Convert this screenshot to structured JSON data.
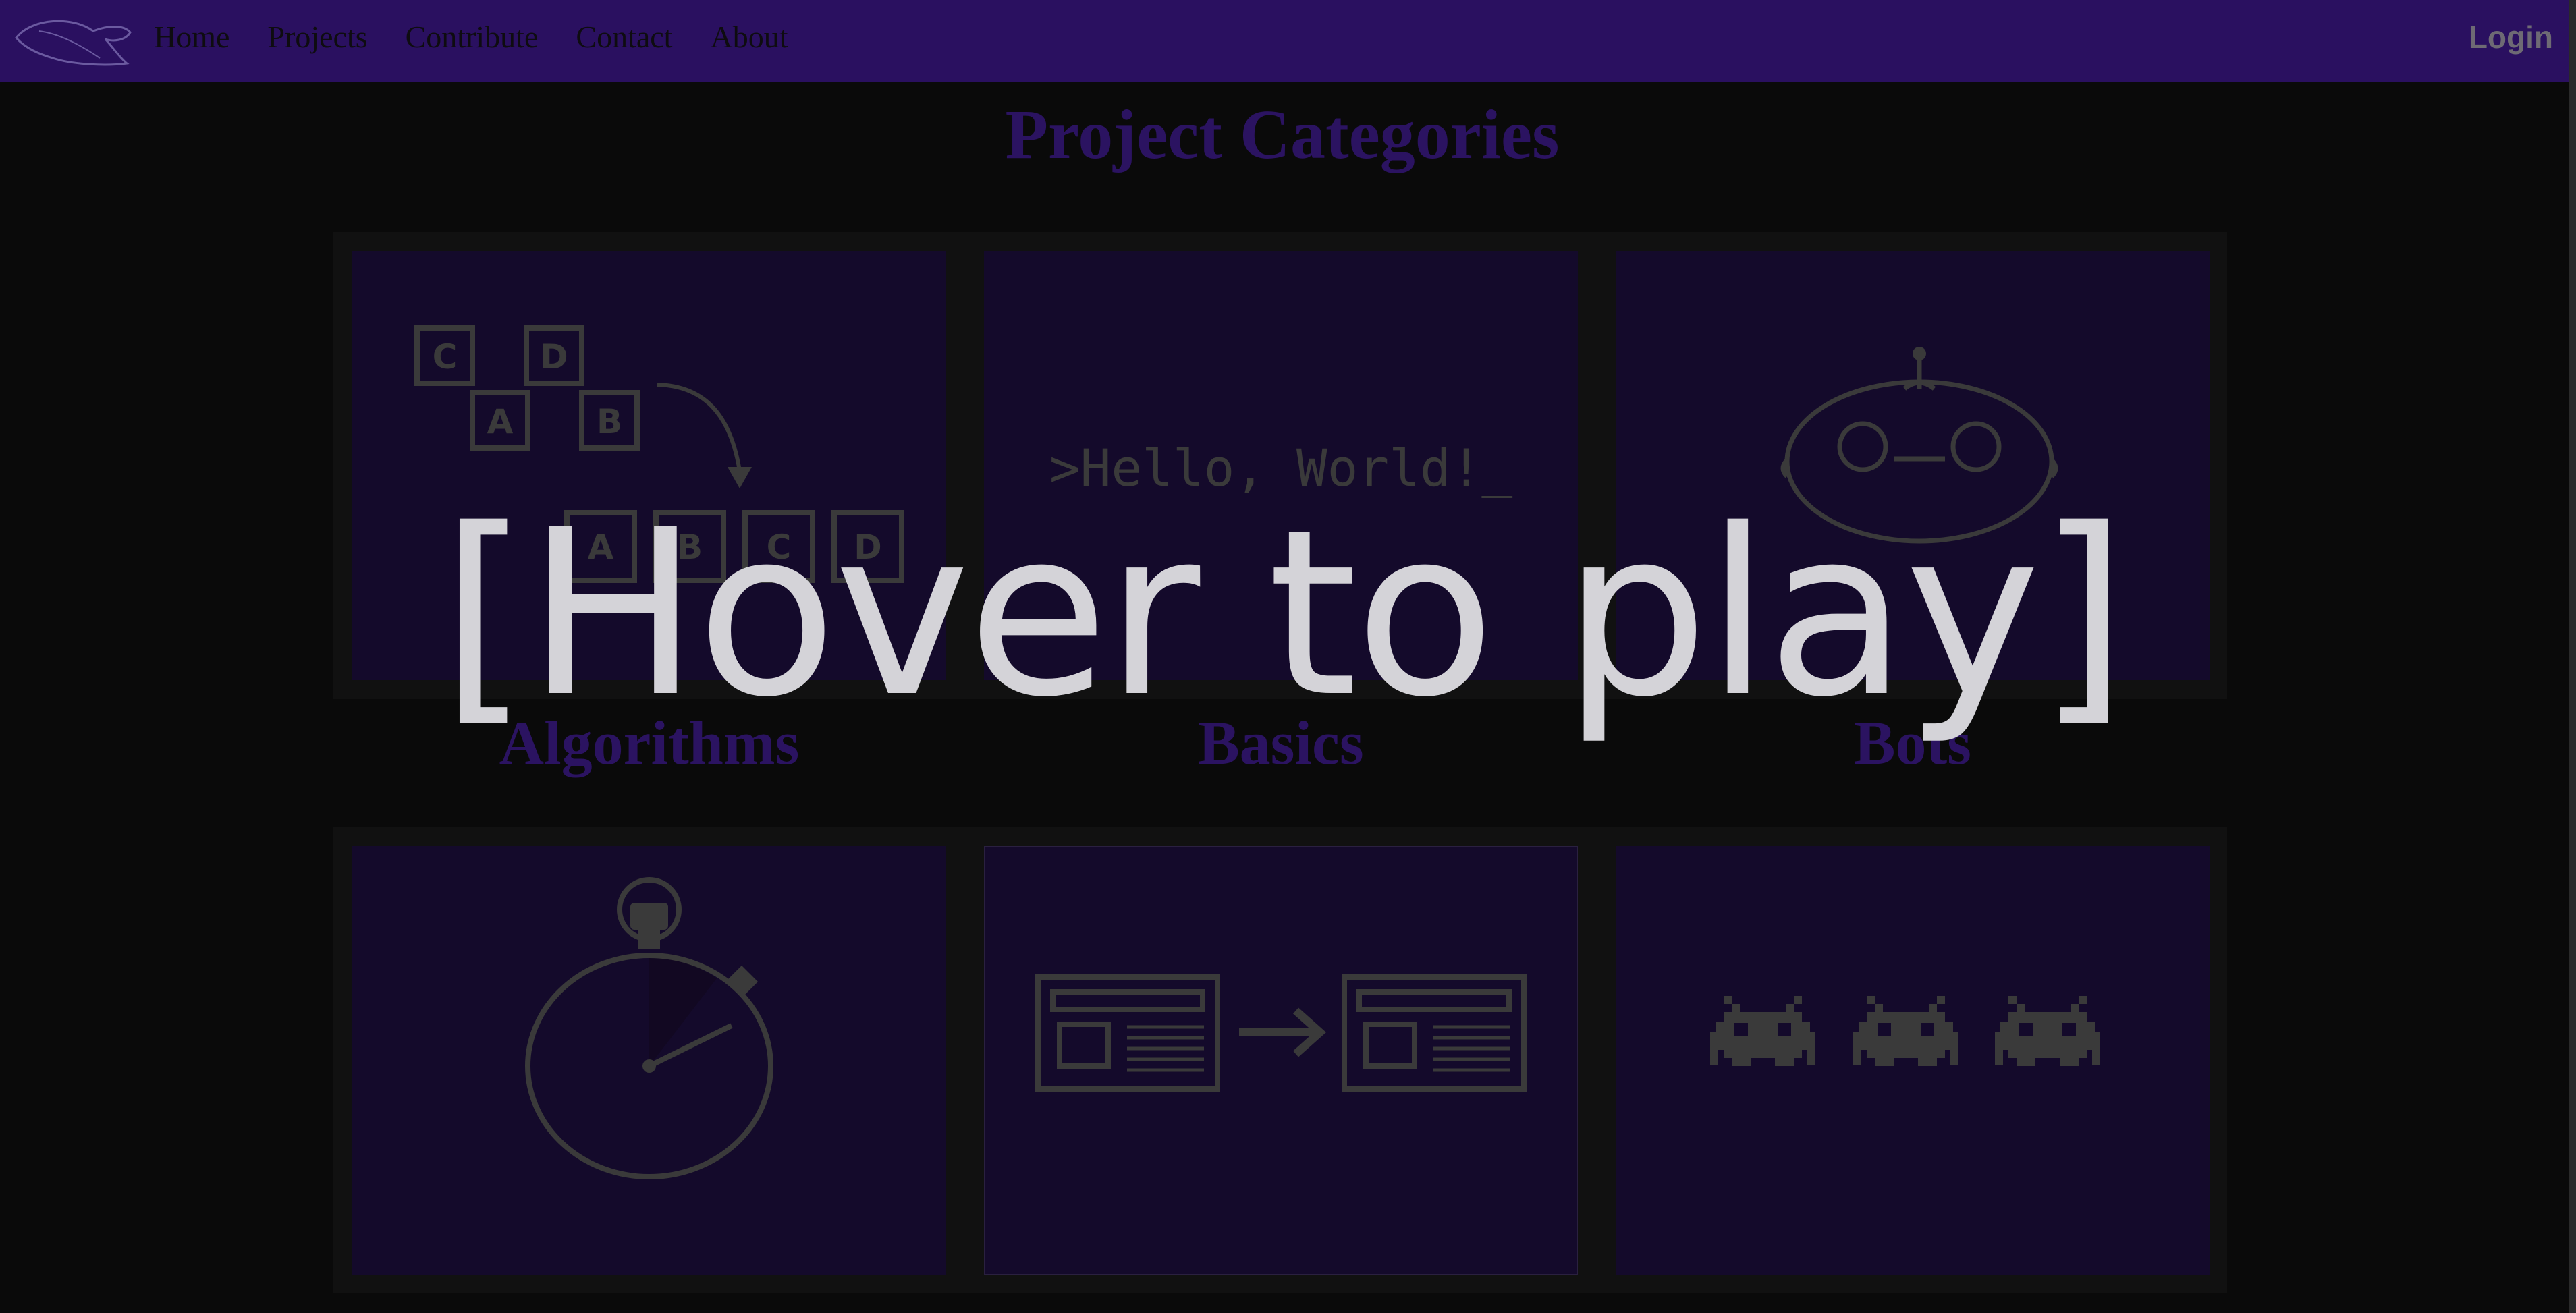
{
  "nav": {
    "logo": "rabbit-logo",
    "links": [
      "Home",
      "Projects",
      "Contribute",
      "Contact",
      "About"
    ],
    "login": "Login"
  },
  "page": {
    "title": "Project Categories"
  },
  "categories": [
    {
      "label": "Algorithms",
      "icon": "sorting-blocks-icon"
    },
    {
      "label": "Basics",
      "icon": "hello-world-terminal-icon",
      "text": ">Hello, World!_"
    },
    {
      "label": "Bots",
      "icon": "robot-head-icon"
    },
    {
      "label": "",
      "icon": "stopwatch-icon"
    },
    {
      "label": "",
      "icon": "webpage-transform-icon"
    },
    {
      "label": "",
      "icon": "space-invaders-icon"
    }
  ],
  "algorithms_blocks": {
    "top": [
      "C",
      "D",
      "A",
      "B"
    ],
    "sorted": [
      "A",
      "B",
      "C",
      "D"
    ]
  },
  "overlay": {
    "text": "[Hover to play]"
  },
  "colors": {
    "navbar": "#2a1060",
    "card": "#140a2b",
    "heading": "#2b1361",
    "icon_stroke": "#3a3a3a"
  }
}
